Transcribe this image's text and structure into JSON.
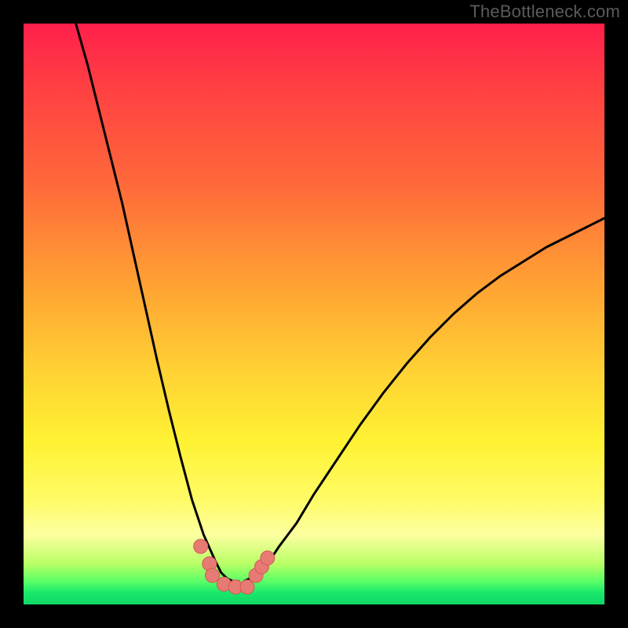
{
  "watermark": "TheBottleneck.com",
  "chart_data": {
    "type": "line",
    "title": "",
    "xlabel": "",
    "ylabel": "",
    "xlim": [
      0,
      100
    ],
    "ylim": [
      0,
      100
    ],
    "series": [
      {
        "name": "left-curve",
        "x": [
          9,
          11,
          13,
          15,
          17,
          19,
          21,
          23,
          25,
          27,
          29,
          31,
          33,
          34,
          35,
          36,
          37
        ],
        "y": [
          100,
          93,
          85,
          77,
          69,
          60,
          51,
          42,
          33.5,
          25.5,
          18,
          12,
          7.5,
          5.5,
          4.5,
          4,
          4
        ]
      },
      {
        "name": "right-curve",
        "x": [
          38,
          40,
          42,
          44,
          47,
          50,
          54,
          58,
          62,
          66,
          70,
          74,
          78,
          82,
          86,
          90,
          94,
          98,
          100
        ],
        "y": [
          4,
          5,
          7,
          10,
          14,
          19,
          25,
          31,
          36.5,
          41.5,
          46,
          50,
          53.5,
          56.5,
          59,
          61.5,
          63.5,
          65.5,
          66.5
        ]
      }
    ],
    "markers": [
      {
        "name": "m1",
        "x": 30.5,
        "y": 10.0
      },
      {
        "name": "m2",
        "x": 32.0,
        "y": 7.0
      },
      {
        "name": "m3",
        "x": 32.5,
        "y": 5.0
      },
      {
        "name": "m4",
        "x": 34.5,
        "y": 3.5
      },
      {
        "name": "m5",
        "x": 36.5,
        "y": 3.0
      },
      {
        "name": "m6",
        "x": 38.5,
        "y": 3.0
      },
      {
        "name": "m7",
        "x": 40.0,
        "y": 5.0
      },
      {
        "name": "m8",
        "x": 41.0,
        "y": 6.5
      },
      {
        "name": "m9",
        "x": 42.0,
        "y": 8.0
      }
    ],
    "marker_style": {
      "fill": "#e77b74",
      "stroke": "#d15a54",
      "r": 9
    },
    "curve_style": {
      "stroke": "#000000",
      "width": 3
    }
  }
}
